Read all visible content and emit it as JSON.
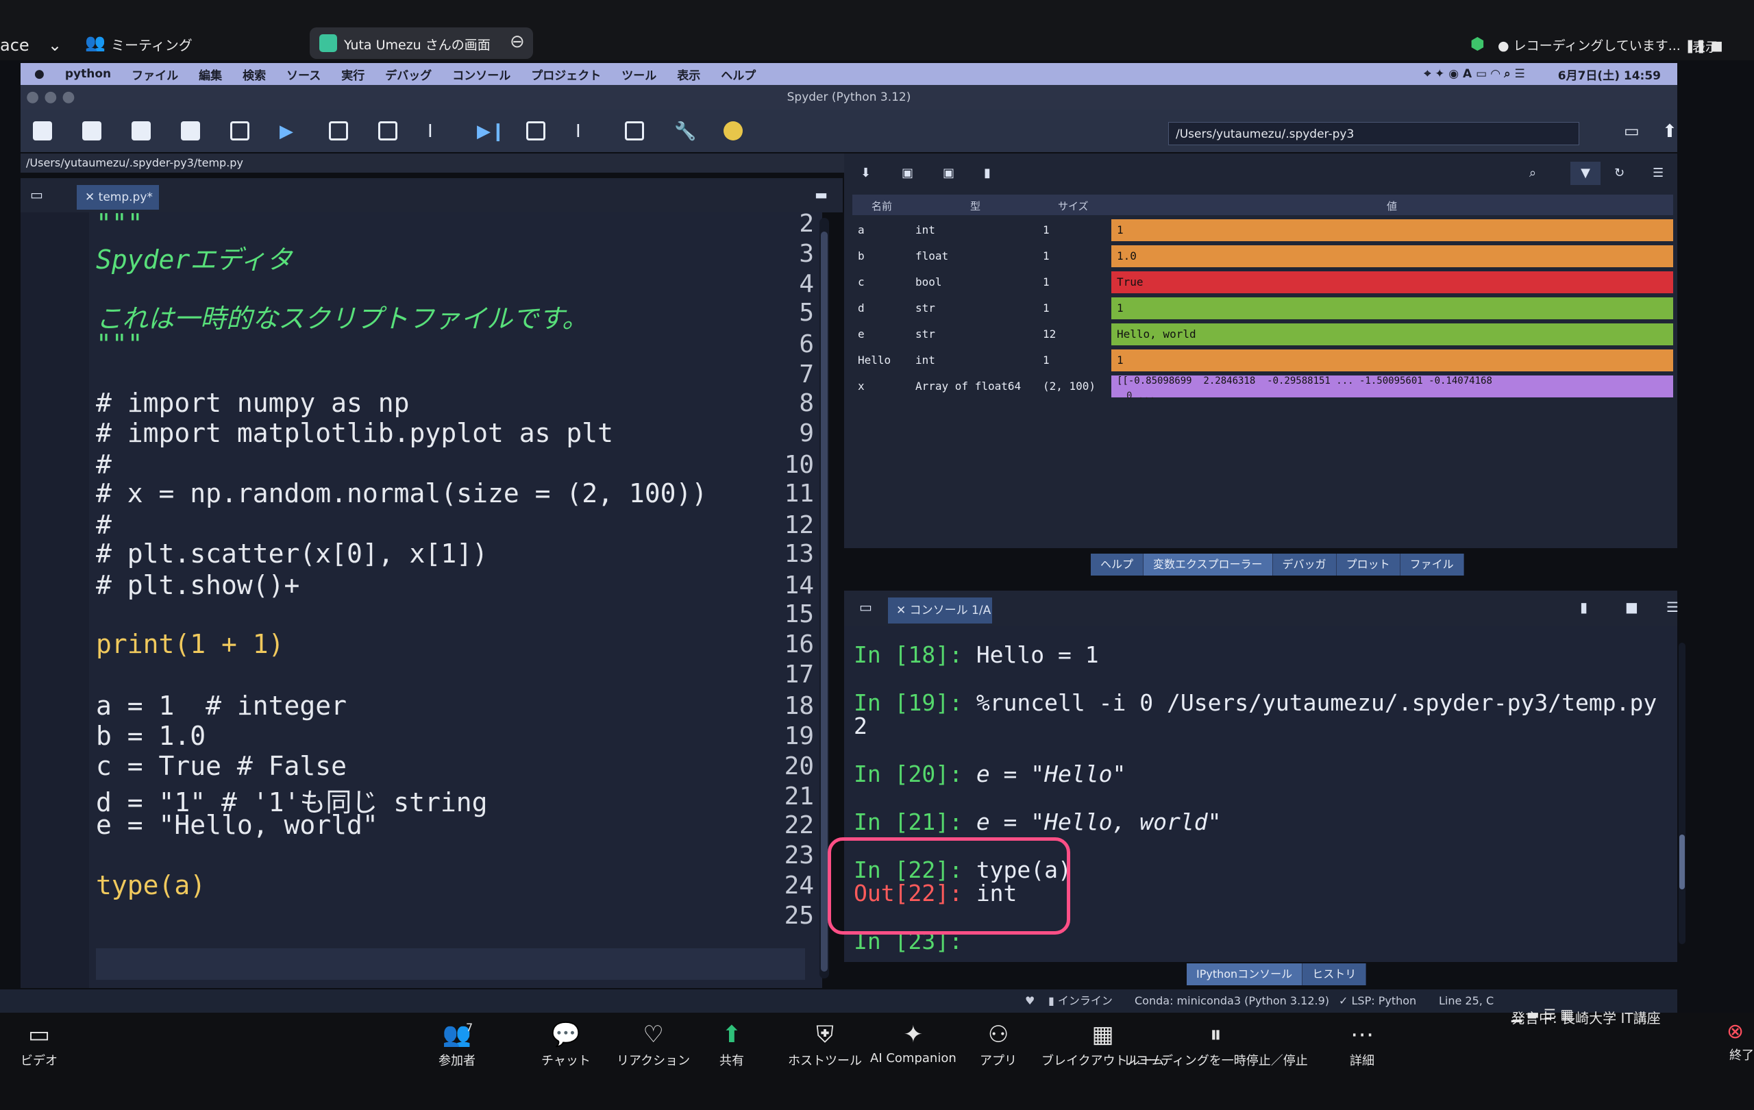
{
  "zoom": {
    "left_cut": "ace",
    "meeting_label": "ミーティング",
    "share_label": "Yuta Umezu さんの画面",
    "recording": "レコーディングしています...",
    "view": "表示",
    "bottom": [
      {
        "label": "ビデオ",
        "icon": "video-icon"
      },
      {
        "label": "参加者",
        "icon": "participants-icon",
        "count": "7"
      },
      {
        "label": "チャット",
        "icon": "chat-icon"
      },
      {
        "label": "リアクション",
        "icon": "reaction-icon"
      },
      {
        "label": "共有",
        "icon": "share-icon"
      },
      {
        "label": "ホストツール",
        "icon": "host-tools-icon"
      },
      {
        "label": "AI Companion",
        "icon": "ai-companion-icon"
      },
      {
        "label": "アプリ",
        "icon": "apps-icon"
      },
      {
        "label": "ブレイクアウトルーム",
        "icon": "breakout-icon"
      },
      {
        "label": "レコーディングを一時停止／停止",
        "icon": "record-control-icon"
      },
      {
        "label": "詳細",
        "icon": "more-icon"
      }
    ],
    "speaker": "発言中: 長崎大学 IT講座",
    "end": "終了"
  },
  "macmenu": [
    "python",
    "ファイル",
    "編集",
    "検索",
    "ソース",
    "実行",
    "デバッグ",
    "コンソール",
    "プロジェクト",
    "ツール",
    "表示",
    "ヘルプ"
  ],
  "clock": "6月7日(土) 14:59",
  "window_title": "Spyder (Python 3.12)",
  "working_dir": "/Users/yutaumezu/.spyder-py3",
  "editor": {
    "path": "/Users/yutaumezu/.spyder-py3/temp.py",
    "tab": "temp.py*",
    "lines": [
      {
        "n": "2",
        "t": "\"\"\""
      },
      {
        "n": "3",
        "t": "Spyderエディタ"
      },
      {
        "n": "4",
        "t": ""
      },
      {
        "n": "5",
        "t": "これは一時的なスクリプトファイルです。"
      },
      {
        "n": "6",
        "t": "\"\"\""
      },
      {
        "n": "7",
        "t": ""
      },
      {
        "n": "8",
        "t": "# import numpy as np"
      },
      {
        "n": "9",
        "t": "# import matplotlib.pyplot as plt"
      },
      {
        "n": "10",
        "t": "#"
      },
      {
        "n": "11",
        "t": "# x = np.random.normal(size = (2, 100))"
      },
      {
        "n": "12",
        "t": "#"
      },
      {
        "n": "13",
        "t": "# plt.scatter(x[0], x[1])"
      },
      {
        "n": "14",
        "t": "# plt.show()+"
      },
      {
        "n": "15",
        "t": ""
      },
      {
        "n": "16",
        "t": "print(1 + 1)"
      },
      {
        "n": "17",
        "t": ""
      },
      {
        "n": "18",
        "t": "a = 1  # integer"
      },
      {
        "n": "19",
        "t": "b = 1.0"
      },
      {
        "n": "20",
        "t": "c = True # False"
      },
      {
        "n": "21",
        "t": "d = \"1\" # '1'も同じ string"
      },
      {
        "n": "22",
        "t": "e = \"Hello, world\""
      },
      {
        "n": "23",
        "t": ""
      },
      {
        "n": "24",
        "t": "type(a)"
      },
      {
        "n": "25",
        "t": ""
      }
    ]
  },
  "varexp": {
    "headers": [
      "名前",
      "型",
      "サイズ",
      "値"
    ],
    "rows": [
      {
        "name": "a",
        "type": "int",
        "size": "1",
        "value": "1",
        "color": "#e2913f"
      },
      {
        "name": "b",
        "type": "float",
        "size": "1",
        "value": "1.0",
        "color": "#e2913f"
      },
      {
        "name": "c",
        "type": "bool",
        "size": "1",
        "value": "True",
        "color": "#d83038"
      },
      {
        "name": "d",
        "type": "str",
        "size": "1",
        "value": "1",
        "color": "#7ab640"
      },
      {
        "name": "e",
        "type": "str",
        "size": "12",
        "value": "Hello, world",
        "color": "#7ab640"
      },
      {
        "name": "Hello",
        "type": "int",
        "size": "1",
        "value": "1",
        "color": "#e2913f"
      },
      {
        "name": "x",
        "type": "Array of float64",
        "size": "(2, 100)",
        "value": "[[-0.85098699  2.2846318  -0.29588151 ... -1.50095601 -0.14074168",
        "value2": "0 ...",
        "color": "#b07ee0"
      }
    ],
    "tabs": [
      "ヘルプ",
      "変数エクスプローラー",
      "デバッガ",
      "プロット",
      "ファイル"
    ]
  },
  "console": {
    "tab": "コンソール 1/A",
    "lines": [
      {
        "p": "In [18]: ",
        "t": "Hello = 1",
        "kind": "in"
      },
      {
        "p": "In [19]: ",
        "t": "%runcell -i 0 /Users/yutaumezu/.spyder-py3/temp.py",
        "kind": "in"
      },
      {
        "p": "",
        "t": "2",
        "kind": "plain"
      },
      {
        "p": "In [20]: ",
        "t": "e = \"Hello\"",
        "kind": "in"
      },
      {
        "p": "In [21]: ",
        "t": "e = \"Hello, world\"",
        "kind": "in"
      },
      {
        "p": "In [22]: ",
        "t": "type(a)",
        "kind": "in"
      },
      {
        "p": "Out[22]: ",
        "t": "int",
        "kind": "out"
      },
      {
        "p": "In [23]: ",
        "t": "",
        "kind": "in"
      }
    ],
    "tabs": [
      "IPythonコンソール",
      "ヒストリ"
    ]
  },
  "status": {
    "online": "インライン",
    "conda": "Conda: miniconda3 (Python 3.12.9)",
    "lsp": "LSP: Python",
    "line": "Line 25, C"
  }
}
